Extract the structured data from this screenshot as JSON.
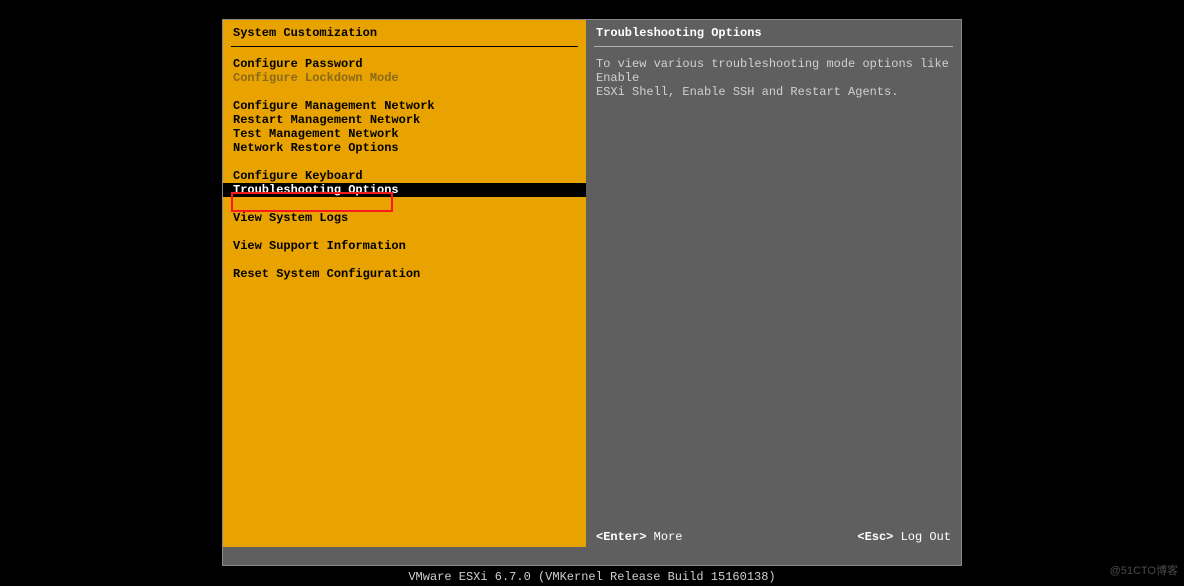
{
  "left": {
    "title": "System Customization",
    "items": [
      "Configure Password",
      "Configure Lockdown Mode",
      "Configure Management Network",
      "Restart Management Network",
      "Test Management Network",
      "Network Restore Options",
      "Configure Keyboard",
      "Troubleshooting Options",
      "View System Logs",
      "View Support Information",
      "Reset System Configuration"
    ]
  },
  "right": {
    "title": "Troubleshooting Options",
    "desc_line1": "To view various troubleshooting mode options like Enable",
    "desc_line2": "ESXi Shell, Enable SSH and Restart Agents."
  },
  "actions": {
    "enter_key": "<Enter>",
    "enter_label": " More",
    "esc_key": "<Esc>",
    "esc_label": " Log Out"
  },
  "footer": "VMware ESXi 6.7.0 (VMKernel Release Build 15160138)",
  "watermark": "@51CTO博客"
}
